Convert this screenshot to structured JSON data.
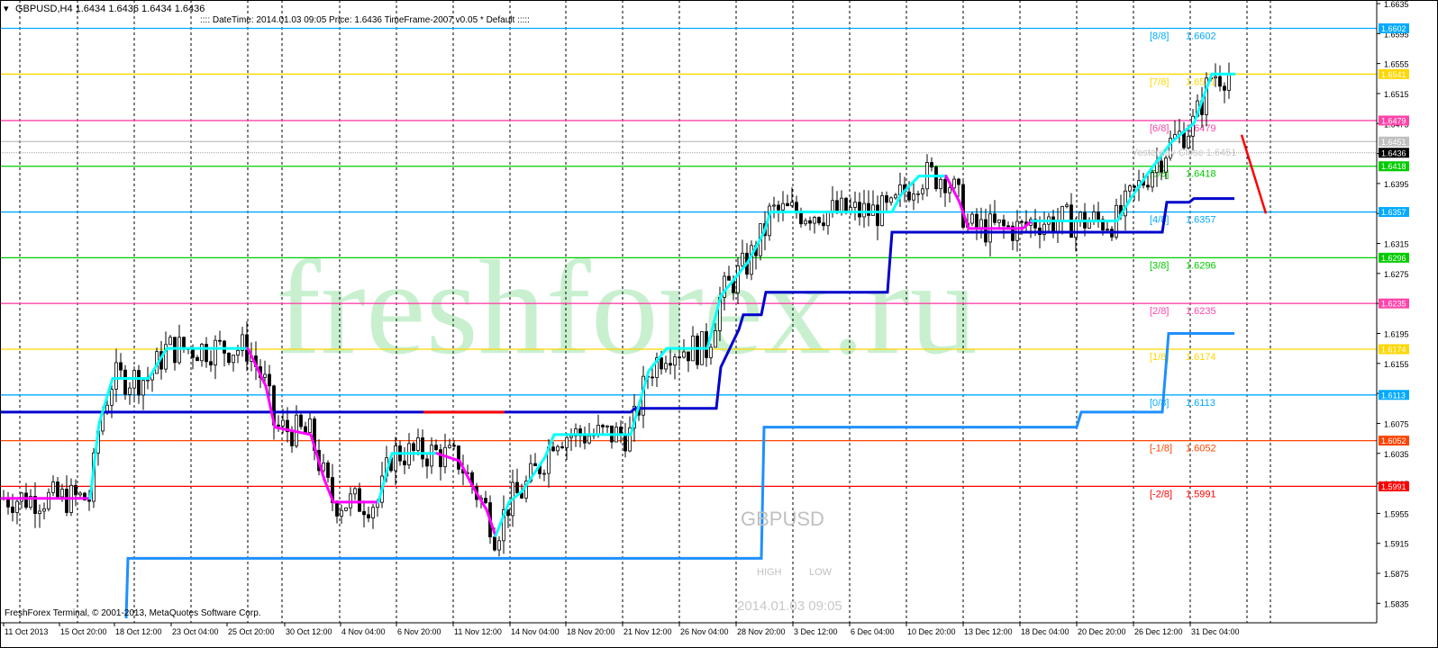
{
  "header": {
    "symbol_info": "GBPUSD,H4  1.6434 1.6436 1.6434 1.6436",
    "indicator_info": ":::: DateTime: 2014.01.03 09:05   Price: 1.6436   TimeFrame-2007 v0.05   *  Default  :::::"
  },
  "watermark": "freshforex.ru",
  "center_labels": {
    "symbol": "GBPUSD",
    "high": "HIGH",
    "low": "LOW",
    "datetime": "2014.01.03 09:05"
  },
  "copyright": "FreshForex Terminal, © 2001-2013, MetaQuotes Software Corp.",
  "yesterday_close_label": "Yesterday Close 1.6451",
  "colors": {
    "background": "#ffffff",
    "grid": "#000000",
    "candle": "#000000",
    "cyan_line": "#00ffff",
    "magenta_line": "#ff00ff",
    "dark_blue_line": "#0000cc",
    "blue_line": "#1e90ff",
    "red_arrow": "#ff0000"
  },
  "chart_data": {
    "type": "candlestick",
    "symbol": "GBPUSD",
    "timeframe": "H4",
    "ylim": [
      1.5815,
      1.6635
    ],
    "x_ticks": [
      "11 Oct 2013",
      "15 Oct 20:00",
      "18 Oct 12:00",
      "23 Oct 04:00",
      "25 Oct 20:00",
      "30 Oct 12:00",
      "4 Nov 04:00",
      "6 Nov 20:00",
      "11 Nov 12:00",
      "14 Nov 04:00",
      "18 Nov 20:00",
      "21 Nov 12:00",
      "26 Nov 04:00",
      "28 Nov 20:00",
      "3 Dec 12:00",
      "6 Dec 04:00",
      "10 Dec 20:00",
      "13 Dec 12:00",
      "18 Dec 04:00",
      "20 Dec 20:00",
      "26 Dec 12:00",
      "31 Dec 04:00"
    ],
    "y_ticks": [
      "1.6635",
      "1.6595",
      "1.6555",
      "1.6515",
      "1.6475",
      "1.6435",
      "1.6395",
      "1.6355",
      "1.6315",
      "1.6275",
      "1.6235",
      "1.6195",
      "1.6155",
      "1.6115",
      "1.6075",
      "1.6035",
      "1.5995",
      "1.5955",
      "1.5915",
      "1.5875",
      "1.5835"
    ],
    "murrey_levels": [
      {
        "label": "[8/8]",
        "value": 1.6602,
        "value_text": "1.6602",
        "color": "#00aaff"
      },
      {
        "label": "[7/8]",
        "value": 1.6541,
        "value_text": "1.6541",
        "color": "#ffd700"
      },
      {
        "label": "[6/8]",
        "value": 1.6479,
        "value_text": "1.6479",
        "color": "#ff44aa"
      },
      {
        "label": "[5/8]",
        "value": 1.6418,
        "value_text": "1.6418",
        "color": "#00cc00"
      },
      {
        "label": "[4/8]",
        "value": 1.6357,
        "value_text": "1.6357",
        "color": "#00aaff"
      },
      {
        "label": "[3/8]",
        "value": 1.6296,
        "value_text": "1.6296",
        "color": "#00cc00"
      },
      {
        "label": "[2/8]",
        "value": 1.6235,
        "value_text": "1.6235",
        "color": "#ff44aa"
      },
      {
        "label": "[1/8]",
        "value": 1.6174,
        "value_text": "1.6174",
        "color": "#ffd700"
      },
      {
        "label": "[0/8]",
        "value": 1.6113,
        "value_text": "1.6113",
        "color": "#00aaff"
      },
      {
        "label": "[-1/8]",
        "value": 1.6052,
        "value_text": "1.6052",
        "color": "#ff4400"
      },
      {
        "label": "[-2/8]",
        "value": 1.5991,
        "value_text": "1.5991",
        "color": "#ff0000"
      }
    ],
    "current_price": {
      "value": 1.6436,
      "text": "1.6436"
    },
    "yesterday_close": {
      "value": 1.6451,
      "text": "1.6451"
    },
    "cyan_magenta_line": [
      [
        0,
        1.5975,
        "m"
      ],
      [
        100,
        1.5975,
        "c"
      ],
      [
        110,
        1.6075,
        "c"
      ],
      [
        125,
        1.6135,
        "c"
      ],
      [
        165,
        1.6135,
        "c"
      ],
      [
        185,
        1.6175,
        "c"
      ],
      [
        275,
        1.6175,
        "m"
      ],
      [
        295,
        1.6125,
        "m"
      ],
      [
        305,
        1.607,
        "m"
      ],
      [
        345,
        1.606,
        "m"
      ],
      [
        360,
        1.6,
        "m"
      ],
      [
        370,
        1.597,
        "m"
      ],
      [
        420,
        1.597,
        "c"
      ],
      [
        435,
        1.6035,
        "c"
      ],
      [
        485,
        1.6035,
        "m"
      ],
      [
        510,
        1.6025,
        "m"
      ],
      [
        525,
        1.599,
        "m"
      ],
      [
        540,
        1.596,
        "m"
      ],
      [
        550,
        1.5925,
        "c"
      ],
      [
        565,
        1.597,
        "c"
      ],
      [
        580,
        1.5985,
        "c"
      ],
      [
        605,
        1.603,
        "c"
      ],
      [
        615,
        1.606,
        "c"
      ],
      [
        700,
        1.606,
        "c"
      ],
      [
        720,
        1.6145,
        "c"
      ],
      [
        740,
        1.6175,
        "c"
      ],
      [
        785,
        1.6175,
        "c"
      ],
      [
        800,
        1.6245,
        "c"
      ],
      [
        830,
        1.629,
        "c"
      ],
      [
        848,
        1.633,
        "c"
      ],
      [
        855,
        1.6357,
        "c"
      ],
      [
        990,
        1.6357,
        "c"
      ],
      [
        1000,
        1.638,
        "c"
      ],
      [
        1020,
        1.6405,
        "c"
      ],
      [
        1050,
        1.6405,
        "m"
      ],
      [
        1065,
        1.637,
        "m"
      ],
      [
        1075,
        1.6335,
        "m"
      ],
      [
        1135,
        1.6335,
        "m"
      ],
      [
        1145,
        1.6345,
        "c"
      ],
      [
        1240,
        1.6345,
        "c"
      ],
      [
        1255,
        1.6375,
        "c"
      ],
      [
        1275,
        1.641,
        "c"
      ],
      [
        1300,
        1.645,
        "c"
      ],
      [
        1325,
        1.6475,
        "c"
      ],
      [
        1345,
        1.6541,
        "c"
      ],
      [
        1370,
        1.6541,
        "c"
      ]
    ],
    "dark_blue_step_line": [
      [
        0,
        1.609
      ],
      [
        560,
        1.609
      ],
      [
        700,
        1.609
      ],
      [
        705,
        1.6095
      ],
      [
        795,
        1.6095
      ],
      [
        800,
        1.615
      ],
      [
        820,
        1.62
      ],
      [
        825,
        1.622
      ],
      [
        845,
        1.622
      ],
      [
        850,
        1.625
      ],
      [
        985,
        1.625
      ],
      [
        990,
        1.633
      ],
      [
        1290,
        1.633
      ],
      [
        1295,
        1.637
      ],
      [
        1320,
        1.637
      ],
      [
        1325,
        1.6375
      ],
      [
        1370,
        1.6375
      ]
    ],
    "blue_step_line": [
      [
        140,
        1.5815
      ],
      [
        142,
        1.5895
      ],
      [
        845,
        1.5895
      ],
      [
        848,
        1.607
      ],
      [
        1195,
        1.607
      ],
      [
        1200,
        1.609
      ],
      [
        1290,
        1.609
      ],
      [
        1297,
        1.6195
      ],
      [
        1370,
        1.6195
      ]
    ],
    "red_forecast_arrow": [
      [
        1378,
        1.646
      ],
      [
        1405,
        1.6355
      ]
    ]
  }
}
